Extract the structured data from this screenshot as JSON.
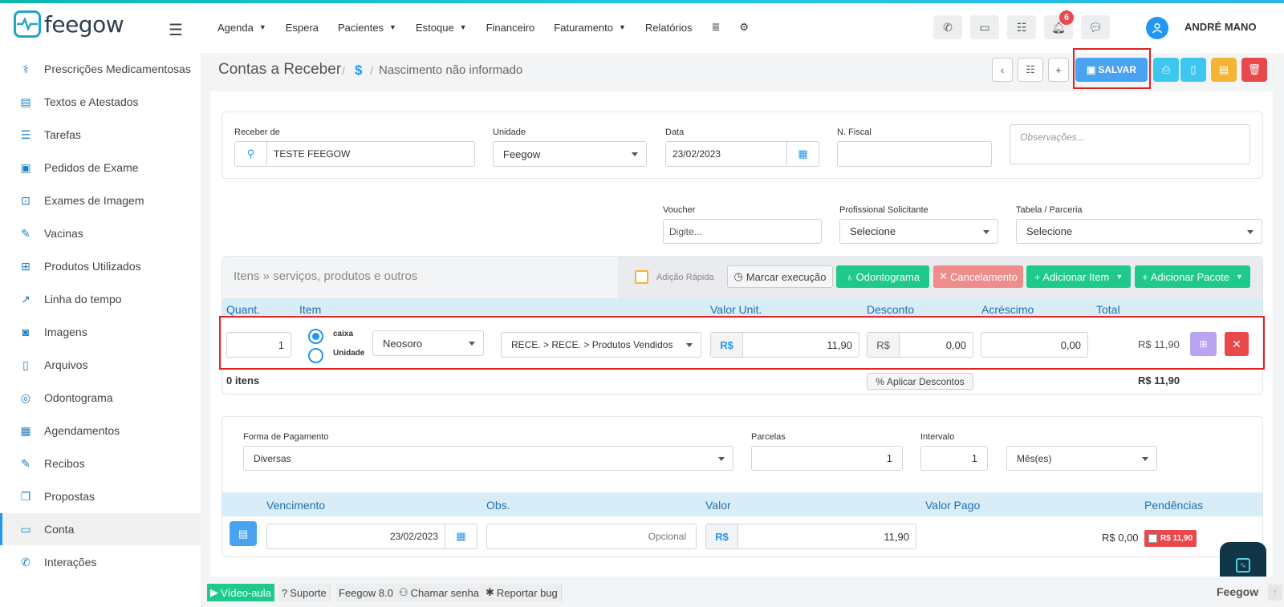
{
  "app": {
    "logo": "feegow",
    "user": "ANDRÉ MANO",
    "notif_count": "6"
  },
  "nav": [
    "Agenda",
    "Espera",
    "Pacientes",
    "Estoque",
    "Financeiro",
    "Faturamento",
    "Relatórios"
  ],
  "sidebar": [
    "Prescrições Medicamentosas",
    "Textos e Atestados",
    "Tarefas",
    "Pedidos de Exame",
    "Exames de Imagem",
    "Vacinas",
    "Produtos Utilizados",
    "Linha do tempo",
    "Imagens",
    "Arquivos",
    "Odontograma",
    "Agendamentos",
    "Recibos",
    "Propostas",
    "Conta",
    "Interações"
  ],
  "header": {
    "title": "Contas a Receber",
    "dollar": "$",
    "breadcrumb": "Nascimento não informado",
    "save": "SALVAR"
  },
  "form": {
    "receber_label": "Receber de",
    "receber_value": "TESTE FEEGOW",
    "unidade_label": "Unidade",
    "unidade_value": "Feegow",
    "data_label": "Data",
    "data_value": "23/02/2023",
    "fiscal_label": "N. Fiscal",
    "obs_placeholder": "Observações...",
    "voucher_label": "Voucher",
    "voucher_placeholder": "Digite...",
    "prof_label": "Profissional Solicitante",
    "prof_value": "Selecione",
    "tabela_label": "Tabela / Parceria",
    "tabela_value": "Selecione"
  },
  "items": {
    "title": "Itens » serviços, produtos e outros",
    "adicao": "Adição Rápida",
    "marcar": "Marcar execução",
    "odonto": "Odontograma",
    "cancel": "Cancelamento",
    "add_item": "Adicionar Item",
    "add_pacote": "Adicionar Pacote",
    "cols": [
      "Quant.",
      "Item",
      "Valor Unit.",
      "Desconto",
      "Acréscimo",
      "Total"
    ],
    "row": {
      "qty": "1",
      "opt1": "caixa",
      "opt2": "Unidade",
      "product": "Neosoro",
      "category": "RECE. > RECE. > Produtos Vendidos",
      "rs": "R$",
      "unit": "11,90",
      "disc": "0,00",
      "acr": "0,00",
      "total": "R$ 11,90"
    },
    "count": "0 itens",
    "apply": "Aplicar Descontos",
    "sum": "R$ 11,90"
  },
  "payment": {
    "forma_label": "Forma de Pagamento",
    "forma_value": "Diversas",
    "parcelas_label": "Parcelas",
    "parcelas_value": "1",
    "intervalo_label": "Intervalo",
    "intervalo_value": "1",
    "periodo": "Mês(es)",
    "cols": [
      "Vencimento",
      "Obs.",
      "Valor",
      "Valor Pago",
      "Pendências"
    ],
    "row": {
      "venc": "23/02/2023",
      "obs_placeholder": "Opcional",
      "rs": "R$",
      "valor": "11,90",
      "pago": "R$ 0,00",
      "pend": "R$ 11,90"
    }
  },
  "footer": {
    "video": "Vídeo-aula",
    "suporte": "Suporte",
    "versao": "Feegow 8.0",
    "senha": "Chamar senha",
    "bug": "Reportar bug",
    "brand": "Feegow"
  },
  "colors": {
    "primary": "#2196f3",
    "green": "#1ec98b",
    "red": "#e8494d",
    "cyan": "#3dc6ef",
    "yellow": "#f5b532"
  }
}
